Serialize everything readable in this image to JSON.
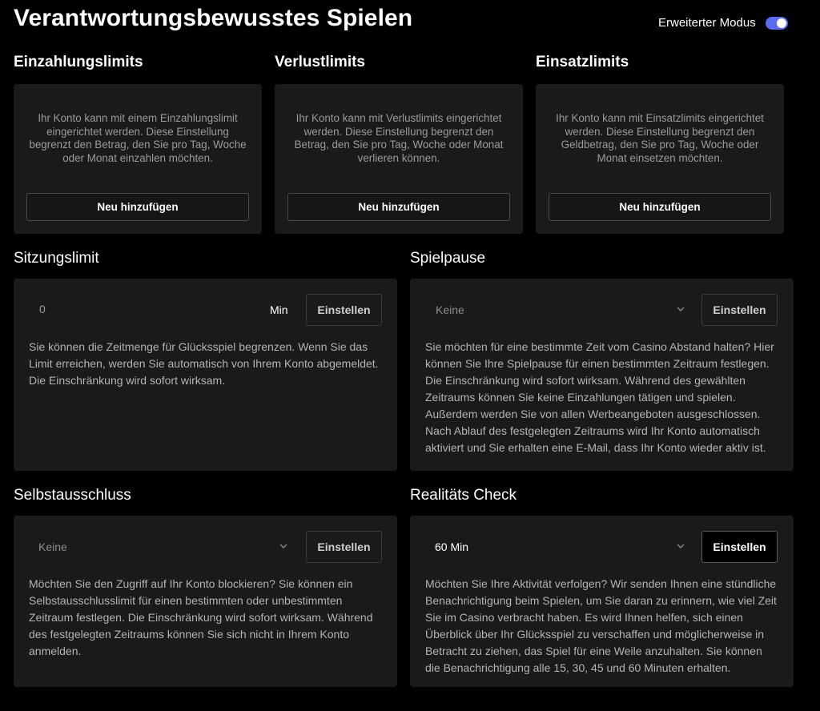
{
  "header": {
    "title": "Verantwortungsbewusstes Spielen",
    "mode_label": "Erweiterter Modus",
    "mode_enabled": true,
    "accent_color": "#5b6cf0"
  },
  "limits": [
    {
      "title": "Einzahlungslimits",
      "text": "Ihr Konto kann mit einem Einzahlungslimit eingerichtet werden. Diese Einstellung begrenzt den Betrag, den Sie pro Tag, Woche oder Monat einzahlen möchten.",
      "button": "Neu hinzufügen"
    },
    {
      "title": "Verlustlimits",
      "text": "Ihr Konto kann mit Verlustlimits eingerichtet werden. Diese Einstellung begrenzt den Betrag, den Sie pro Tag, Woche oder Monat verlieren können.",
      "button": "Neu hinzufügen"
    },
    {
      "title": "Einsatzlimits",
      "text": "Ihr Konto kann mit Einsatzlimits eingerichtet werden. Diese Einstellung begrenzt den Geldbetrag, den Sie pro Tag, Woche oder Monat einsetzen möchten.",
      "button": "Neu hinzufügen"
    }
  ],
  "session": {
    "title": "Sitzungslimit",
    "value": "0",
    "unit": "Min",
    "button": "Einstellen",
    "text": "Sie können die Zeitmenge für Glücksspiel begrenzen. Wenn Sie das Limit erreichen, werden Sie automatisch von Ihrem Konto abgemeldet. Die Einschränkung wird sofort wirksam."
  },
  "pause": {
    "title": "Spielpause",
    "selected": "Keine",
    "button": "Einstellen",
    "text": "Sie möchten für eine bestimmte Zeit vom Casino Abstand halten? Hier können Sie Ihre Spielpause für einen bestimmten Zeitraum festlegen. Die Einschränkung wird sofort wirksam. Während des gewählten Zeitraums können Sie keine Einzahlungen tätigen und spielen. Außerdem werden Sie von allen Werbeangeboten ausgeschlossen. Nach Ablauf des festgelegten Zeitraums wird Ihr Konto automatisch aktiviert und Sie erhalten eine E-Mail, dass Ihr Konto wieder aktiv ist."
  },
  "exclusion": {
    "title": "Selbstausschluss",
    "selected": "Keine",
    "button": "Einstellen",
    "text": "Möchten Sie den Zugriff auf Ihr Konto blockieren? Sie können ein Selbstausschlusslimit für einen bestimmten oder unbestimmten Zeitraum festlegen. Die Einschränkung wird sofort wirksam. Während des festgelegten Zeitraums können Sie sich nicht in Ihrem Konto anmelden."
  },
  "reality": {
    "title": "Realitäts Check",
    "selected": "60 Min",
    "button": "Einstellen",
    "text": "Möchten Sie Ihre Aktivität verfolgen? Wir senden Ihnen eine stündliche Benachrichtigung beim Spielen, um Sie daran zu erinnern, wie viel Zeit Sie im Casino verbracht haben. Es wird Ihnen helfen, sich einen Überblick über Ihr Glücksspiel zu verschaffen und möglicherweise in Betracht zu ziehen, das Spiel für eine Weile anzuhalten. Sie können die Benachrichtigung alle 15, 30, 45 und 60 Minuten erhalten."
  },
  "icons": {
    "select_arrow": "chevron-down-icon"
  }
}
